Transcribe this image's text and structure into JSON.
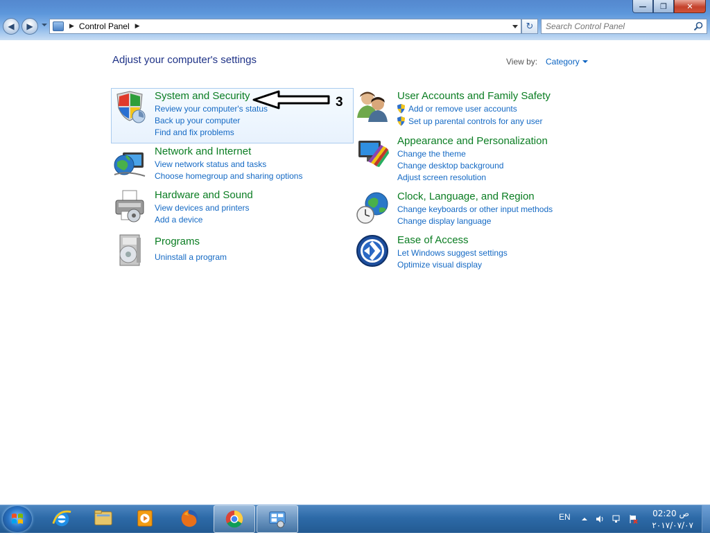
{
  "window": {
    "buttons": {
      "minimize": "—",
      "maximize": "❐",
      "close": "✕"
    }
  },
  "nav": {
    "back_icon": "◀",
    "forward_icon": "▶",
    "breadcrumb": [
      "Control Panel"
    ],
    "refresh_icon": "↻",
    "search_placeholder": "Search Control Panel"
  },
  "header": {
    "title": "Adjust your computer's settings",
    "view_by_label": "View by:",
    "view_by_value": "Category"
  },
  "categories": [
    {
      "title": "System and Security",
      "links": [
        "Review your computer's status",
        "Back up your computer",
        "Find and fix problems"
      ]
    },
    {
      "title": "Network and Internet",
      "links": [
        "View network status and tasks",
        "Choose homegroup and sharing options"
      ]
    },
    {
      "title": "Hardware and Sound",
      "links": [
        "View devices and printers",
        "Add a device"
      ]
    },
    {
      "title": "Programs",
      "links": [
        "Uninstall a program"
      ]
    },
    {
      "title": "User Accounts and Family Safety",
      "links": [
        "Add or remove user accounts",
        "Set up parental controls for any user"
      ]
    },
    {
      "title": "Appearance and Personalization",
      "links": [
        "Change the theme",
        "Change desktop background",
        "Adjust screen resolution"
      ]
    },
    {
      "title": "Clock, Language, and Region",
      "links": [
        "Change keyboards or other input methods",
        "Change display language"
      ]
    },
    {
      "title": "Ease of Access",
      "links": [
        "Let Windows suggest settings",
        "Optimize visual display"
      ]
    }
  ],
  "annotation": {
    "number": "3"
  },
  "taskbar": {
    "pinned": [
      "internet-explorer-icon",
      "file-explorer-icon",
      "media-player-icon",
      "firefox-icon",
      "chrome-icon",
      "control-panel-icon"
    ],
    "language": "EN",
    "time": "02:20 ص",
    "date": "٢٠١٧/٠٧/٠٧"
  },
  "colors": {
    "category_title": "#0a7d22",
    "link": "#1469c4",
    "page_title": "#1e3287",
    "taskbar": "#2d6aa8"
  }
}
